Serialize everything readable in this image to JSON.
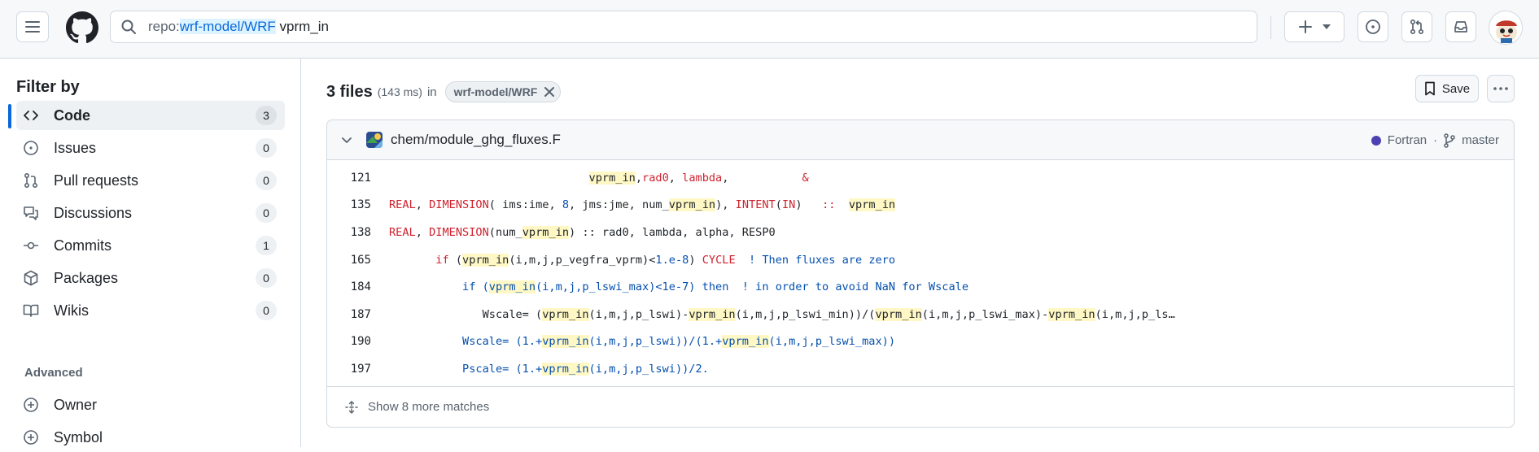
{
  "header": {
    "search": {
      "key": "repo:",
      "value": "wrf-model/WRF",
      "term": " vprm_in"
    },
    "buttons": [
      "create-new",
      "issues",
      "pull-requests",
      "inbox"
    ]
  },
  "sidebar": {
    "title": "Filter by",
    "items": [
      {
        "label": "Code",
        "count": "3",
        "icon": "code-icon"
      },
      {
        "label": "Issues",
        "count": "0",
        "icon": "issue-opened-icon"
      },
      {
        "label": "Pull requests",
        "count": "0",
        "icon": "git-pull-request-icon"
      },
      {
        "label": "Discussions",
        "count": "0",
        "icon": "comment-discussion-icon"
      },
      {
        "label": "Commits",
        "count": "1",
        "icon": "git-commit-icon"
      },
      {
        "label": "Packages",
        "count": "0",
        "icon": "package-icon"
      },
      {
        "label": "Wikis",
        "count": "0",
        "icon": "book-icon"
      }
    ],
    "advanced_title": "Advanced",
    "advanced_items": [
      {
        "label": "Owner",
        "icon": "plus-circle-icon"
      },
      {
        "label": "Symbol",
        "icon": "plus-circle-icon"
      }
    ]
  },
  "main": {
    "results_count": "3 files",
    "results_time": "(143 ms)",
    "results_in": "in",
    "repo_chip": "wrf-model/WRF",
    "save_label": "Save",
    "card": {
      "path": "chem/module_ghg_fluxes.F",
      "language": "Fortran",
      "language_color": "#4d41b1",
      "separator": "·",
      "branch": "master",
      "show_more": "Show 8 more matches",
      "lines": [
        {
          "num": "121"
        },
        {
          "num": "135"
        },
        {
          "num": "138"
        },
        {
          "num": "165"
        },
        {
          "num": "184"
        },
        {
          "num": "187"
        },
        {
          "num": "190"
        },
        {
          "num": "197"
        }
      ]
    }
  }
}
